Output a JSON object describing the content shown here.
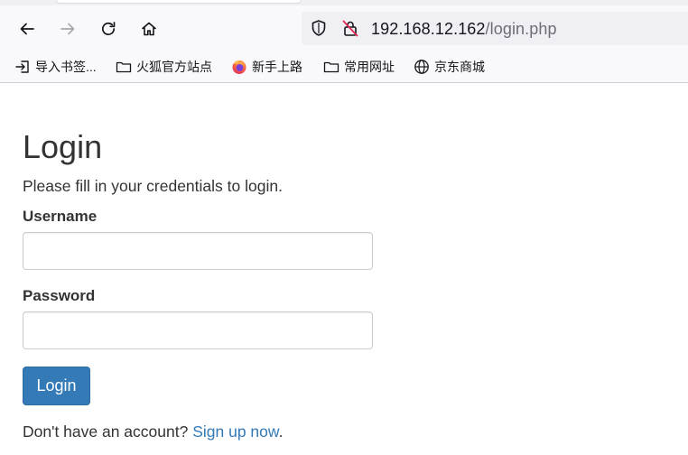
{
  "browser": {
    "url": {
      "host": "192.168.12.162",
      "path": "/login.php"
    },
    "bookmarks": [
      {
        "label": "导入书签...",
        "icon": "import-icon"
      },
      {
        "label": "火狐官方站点",
        "icon": "folder-icon"
      },
      {
        "label": "新手上路",
        "icon": "firefox-icon"
      },
      {
        "label": "常用网址",
        "icon": "folder-icon"
      },
      {
        "label": "京东商城",
        "icon": "globe-icon"
      }
    ]
  },
  "page": {
    "title": "Login",
    "subtitle": "Please fill in your credentials to login.",
    "username": {
      "label": "Username",
      "value": ""
    },
    "password": {
      "label": "Password",
      "value": ""
    },
    "login_button": "Login",
    "signup": {
      "prefix": "Don't have an account? ",
      "link": "Sign up now",
      "suffix": "."
    }
  },
  "colors": {
    "primary": "#337ab7",
    "text": "#333333",
    "input_border": "#cccccc",
    "chrome_bg": "#f9f9fb",
    "urlbar_bg": "#f0f0f4"
  }
}
